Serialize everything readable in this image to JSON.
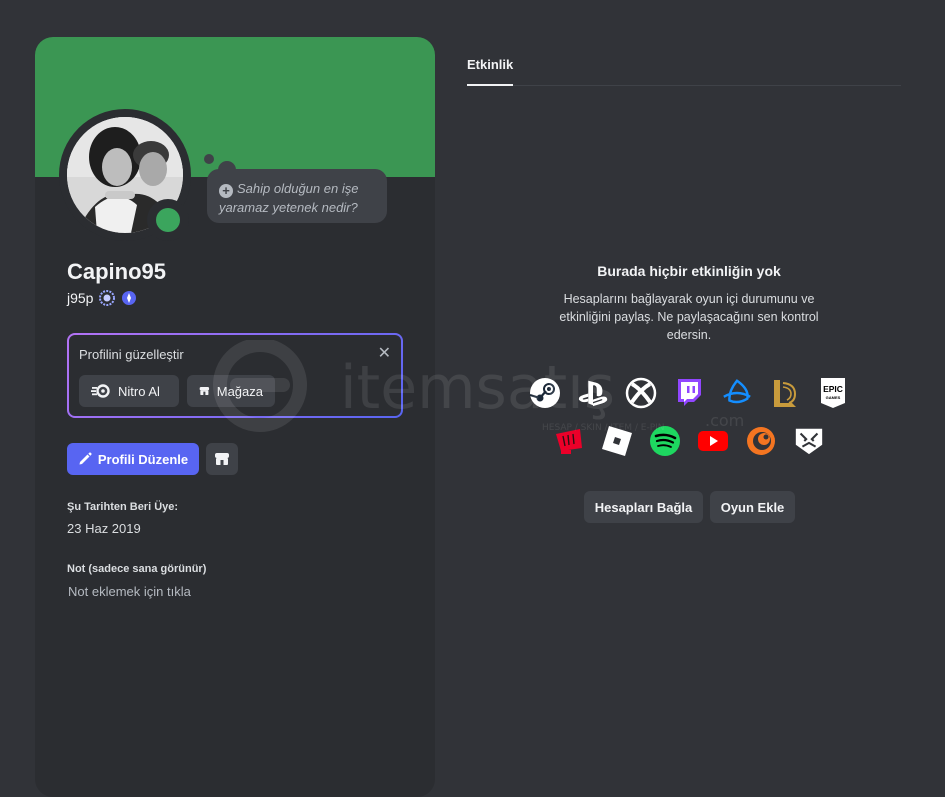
{
  "profile": {
    "display_name": "Capino95",
    "username": "j95p",
    "status_bubble": "Sahip olduğun en işe yaramaz yetenek nedir?",
    "banner_color": "#3b9653",
    "status_color": "#3ba55d"
  },
  "customize": {
    "title": "Profilini güzelleştir",
    "nitro_label": "Nitro Al",
    "shop_label": "Mağaza"
  },
  "actions": {
    "edit_profile": "Profili Düzenle"
  },
  "member_since": {
    "label": "Şu Tarihten Beri Üye:",
    "value": "23 Haz 2019"
  },
  "note": {
    "label": "Not (sadece sana görünür)",
    "placeholder": "Not eklemek için tıkla"
  },
  "activity": {
    "tab_label": "Etkinlik",
    "empty_title": "Burada hiçbir etkinliğin yok",
    "empty_desc": "Hesaplarını bağlayarak oyun içi durumunu ve etkinliğini paylaş. Ne paylaşacağını sen kontrol edersin.",
    "platforms_row1": [
      "steam-icon",
      "playstation-icon",
      "xbox-icon",
      "twitch-icon",
      "battlenet-icon",
      "league-of-legends-icon",
      "epic-games-icon"
    ],
    "platforms_row2": [
      "riot-games-icon",
      "roblox-icon",
      "spotify-icon",
      "youtube-icon",
      "crunchyroll-icon",
      "bungie-icon"
    ],
    "epic_label": "EPIC",
    "epic_sub": "GAMES",
    "connect_button": "Hesapları Bağla",
    "add_game_button": "Oyun Ekle"
  },
  "watermark": {
    "brand": "itemsatış",
    "tagline": "HESAP / SKIN / ITEM / E-PIN",
    "domain": ".com"
  },
  "accent_colors": {
    "blurple": "#5865f2",
    "background": "#313338",
    "card": "#2b2d31"
  }
}
